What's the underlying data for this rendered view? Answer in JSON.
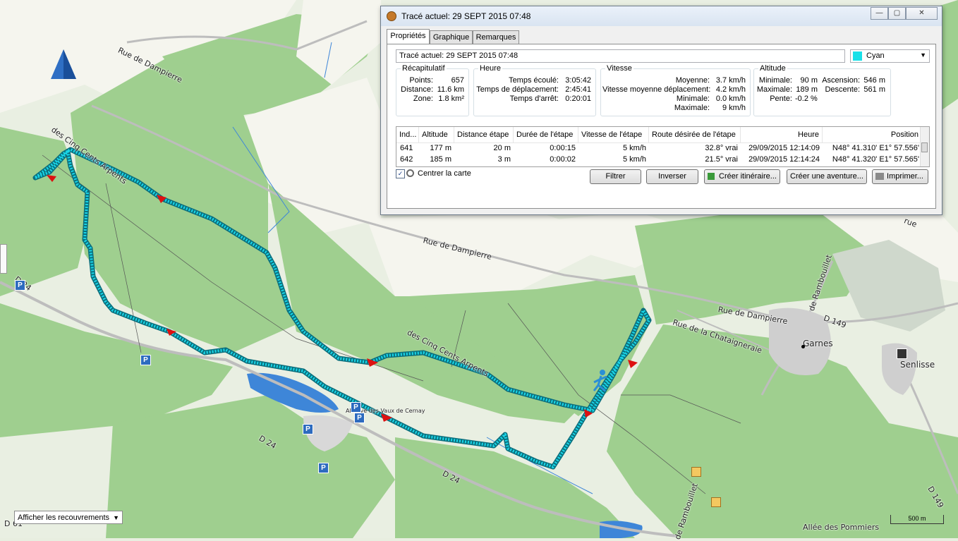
{
  "colors": {
    "map_bg": "#e8eee0",
    "forest": "#9fcf8f",
    "field": "#f6f6ec",
    "track": "#19d6e8",
    "water": "#3e86d8",
    "dialog_bg": "#f0f0f0"
  },
  "map": {
    "labels": {
      "rue_dampierre_1": "Rue de Dampierre",
      "rue_dampierre_2": "Rue de Dampierre",
      "rue_dampierre_3": "Rue de Dampierre",
      "cinq_cents_1": "des Cinq Cents Arpents",
      "cinq_cents_2": "des Cinq Cents Arpents",
      "d24_left": "D 24",
      "d24_mid": "D 24",
      "d24_bottom": "D 24",
      "d61": "D 61",
      "d149": "D 149",
      "d149b": "D 149",
      "chataigneraie": "Rue de la Chataigneraie",
      "rambouillet": "de Rambouillet",
      "rambouillet2": "de Rambouillet",
      "garnes": "Garnes",
      "senlisse": "Senlisse",
      "pommiers": "Allée des Pommiers",
      "abbaye": "Abbaye des Vaux de Cernay",
      "rue_edge": "rue"
    },
    "parking": [
      "P",
      "P",
      "P",
      "P",
      "P",
      "P"
    ],
    "overlay_select": "Afficher les recouvrements",
    "scale_label": "500 m"
  },
  "dialog": {
    "title": "Tracé actuel: 29 SEPT 2015 07:48",
    "tabs": [
      "Propriétés",
      "Graphique",
      "Remarques"
    ],
    "name_value": "Tracé actuel: 29 SEPT 2015 07:48",
    "color_value": "Cyan",
    "recap": {
      "title": "Récapitulatif",
      "points_label": "Points:",
      "points": "657",
      "distance_label": "Distance:",
      "distance": "11.6 km",
      "zone_label": "Zone:",
      "zone": "1.8 km²"
    },
    "time": {
      "title": "Heure",
      "elapsed_label": "Temps écoulé:",
      "elapsed": "3:05:42",
      "moving_label": "Temps de déplacement:",
      "moving": "2:45:41",
      "stopped_label": "Temps d'arrêt:",
      "stopped": "0:20:01"
    },
    "speed": {
      "title": "Vitesse",
      "avg_label": "Moyenne:",
      "avg": "3.7 km/h",
      "moving_avg_label": "Vitesse moyenne déplacement:",
      "moving_avg": "4.2 km/h",
      "min_label": "Minimale:",
      "min": "0.0 km/h",
      "max_label": "Maximale:",
      "max": "9 km/h"
    },
    "altitude": {
      "title": "Altitude",
      "min_label": "Minimale:",
      "min": "90 m",
      "max_label": "Maximale:",
      "max": "189 m",
      "slope_label": "Pente:",
      "slope": "-0.2 %",
      "ascent_label": "Ascension:",
      "ascent": "546 m",
      "descent_label": "Descente:",
      "descent": "561 m"
    },
    "table": {
      "headers": [
        "Ind...",
        "Altitude",
        "Distance étape",
        "Durée de l'étape",
        "Vitesse de l'étape",
        "Route désirée de l'étape",
        "Heure",
        "Position"
      ],
      "rows": [
        [
          "641",
          "177 m",
          "20 m",
          "0:00:15",
          "5 km/h",
          "32.8° vrai",
          "29/09/2015 12:14:09",
          "N48° 41.310' E1° 57.556'"
        ],
        [
          "642",
          "185 m",
          "3 m",
          "0:00:02",
          "5 km/h",
          "21.5° vrai",
          "29/09/2015 12:14:24",
          "N48° 41.320' E1° 57.565'"
        ]
      ]
    },
    "center_map_label": "Centrer la carte",
    "buttons": {
      "filter": "Filtrer",
      "invert": "Inverser",
      "create_route": "Créer itinéraire...",
      "create_adventure": "Créer une aventure...",
      "print": "Imprimer..."
    }
  }
}
